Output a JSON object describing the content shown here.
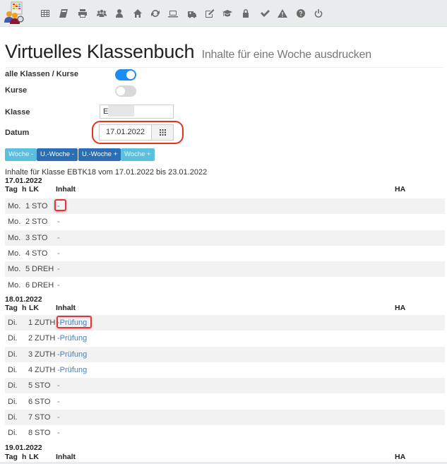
{
  "navbar": {
    "icons": [
      "logo-icon",
      "table-icon",
      "book-icon",
      "print-icon",
      "group-icon",
      "user-icon",
      "home-icon",
      "refresh-icon",
      "laptop-icon",
      "ambulance-icon",
      "edit-icon",
      "graduation-cap-icon",
      "lock-icon",
      "check-icon",
      "warning-icon",
      "help-icon",
      "power-icon"
    ]
  },
  "header": {
    "title": "Virtuelles Klassenbuch",
    "subtitle": "Inhalte für eine Woche ausdrucken"
  },
  "form": {
    "all_classes_label": "alle Klassen / Kurse",
    "all_classes_on": true,
    "courses_label": "Kurse",
    "courses_on": false,
    "class_label": "Klasse",
    "class_value": "EBT",
    "date_label": "Datum",
    "date_value": "17.01.2022"
  },
  "buttons": {
    "week_minus": "Woche -",
    "school_week_minus": "U.-Woche -",
    "school_week_plus": "U.-Woche +",
    "week_plus": "Woche +"
  },
  "info": "Inhalte für Klasse EBTK18 vom 17.01.2022 bis 23.01.2022",
  "columns": {
    "tag": "Tag",
    "h": "h",
    "lk": "LK",
    "inhalt": "Inhalt",
    "ha": "HA"
  },
  "days": [
    {
      "date": "17.01.2022",
      "rows": [
        {
          "tag": "Mo.",
          "h": "1",
          "lk": "STO",
          "inhalt": "-"
        },
        {
          "tag": "Mo.",
          "h": "2",
          "lk": "STO",
          "inhalt": "-"
        },
        {
          "tag": "Mo.",
          "h": "3",
          "lk": "STO",
          "inhalt": "-"
        },
        {
          "tag": "Mo.",
          "h": "4",
          "lk": "STO",
          "inhalt": "-"
        },
        {
          "tag": "Mo.",
          "h": "5",
          "lk": "DREH",
          "inhalt": "-"
        },
        {
          "tag": "Mo.",
          "h": "6",
          "lk": "DREH",
          "inhalt": "-"
        }
      ]
    },
    {
      "date": "18.01.2022",
      "rows": [
        {
          "tag": "Di.",
          "h": "1",
          "lk": "ZUTH",
          "inhalt": "-Prüfung"
        },
        {
          "tag": "Di.",
          "h": "2",
          "lk": "ZUTH",
          "inhalt": "-Prüfung"
        },
        {
          "tag": "Di.",
          "h": "3",
          "lk": "ZUTH",
          "inhalt": "-Prüfung"
        },
        {
          "tag": "Di.",
          "h": "4",
          "lk": "ZUTH",
          "inhalt": "-Prüfung"
        },
        {
          "tag": "Di.",
          "h": "5",
          "lk": "STO",
          "inhalt": "-"
        },
        {
          "tag": "Di.",
          "h": "6",
          "lk": "STO",
          "inhalt": "-"
        },
        {
          "tag": "Di.",
          "h": "7",
          "lk": "STO",
          "inhalt": "-"
        },
        {
          "tag": "Di.",
          "h": "8",
          "lk": "STO",
          "inhalt": "-"
        }
      ]
    },
    {
      "date": "19.01.2022",
      "rows": []
    }
  ]
}
